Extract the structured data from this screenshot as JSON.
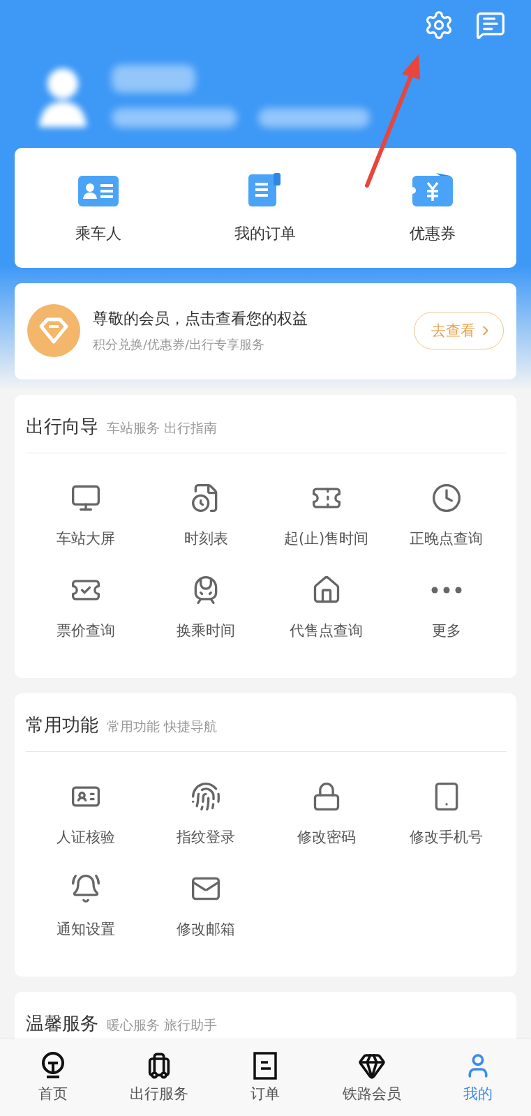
{
  "header_actions": [
    {
      "kind": "settings"
    },
    {
      "kind": "messages"
    }
  ],
  "quick_links": [
    {
      "label": "乘车人"
    },
    {
      "label": "我的订单"
    },
    {
      "label": "优惠券"
    }
  ],
  "member_banner": {
    "title": "尊敬的会员，点击查看您的权益",
    "subtitle": "积分兑换/优惠券/出行专享服务",
    "button": "去查看"
  },
  "sections": [
    {
      "title": "出行向导",
      "subtitle": "车站服务 出行指南",
      "items": [
        {
          "label": "车站大屏"
        },
        {
          "label": "时刻表"
        },
        {
          "label": "起(止)售时间"
        },
        {
          "label": "正晚点查询"
        },
        {
          "label": "票价查询"
        },
        {
          "label": "换乘时间"
        },
        {
          "label": "代售点查询"
        },
        {
          "label": "更多"
        }
      ]
    },
    {
      "title": "常用功能",
      "subtitle": "常用功能 快捷导航",
      "items": [
        {
          "label": "人证核验"
        },
        {
          "label": "指纹登录"
        },
        {
          "label": "修改密码"
        },
        {
          "label": "修改手机号"
        },
        {
          "label": "通知设置"
        },
        {
          "label": "修改邮箱"
        }
      ]
    },
    {
      "title": "温馨服务",
      "subtitle": "暖心服务 旅行助手"
    }
  ],
  "tab_bar": [
    {
      "label": "首页",
      "selected": false
    },
    {
      "label": "出行服务",
      "selected": false
    },
    {
      "label": "订单",
      "selected": false
    },
    {
      "label": "铁路会员",
      "selected": false
    },
    {
      "label": "我的",
      "selected": true
    }
  ]
}
